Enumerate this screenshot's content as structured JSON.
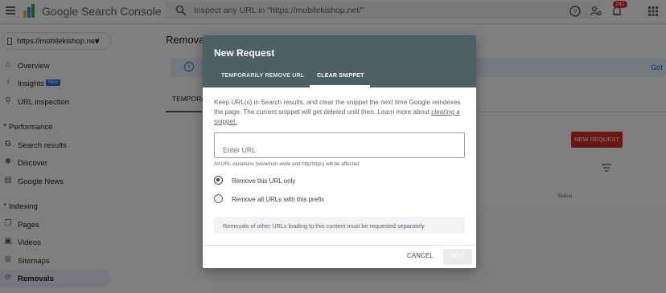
{
  "app": {
    "brand": "Google Search Console",
    "search_placeholder": "Inspect any URL in \"https://mobilekishop.net/\"",
    "notification_count": "241"
  },
  "sidebar": {
    "property": "https://mobilekishop.net/",
    "items": [
      {
        "label": "Overview",
        "icon": "home-icon"
      },
      {
        "label": "Insights",
        "icon": "lightbulb-icon",
        "badge": "New"
      },
      {
        "label": "URL inspection",
        "icon": "search-icon"
      },
      {
        "label": "Performance",
        "section": true
      },
      {
        "label": "Search results",
        "icon": "google-g-icon"
      },
      {
        "label": "Discover",
        "icon": "asterisk-icon"
      },
      {
        "label": "Google News",
        "icon": "news-icon"
      },
      {
        "label": "Indexing",
        "section": true
      },
      {
        "label": "Pages",
        "icon": "pages-icon"
      },
      {
        "label": "Videos",
        "icon": "videos-icon"
      },
      {
        "label": "Sitemaps",
        "icon": "sitemaps-icon"
      },
      {
        "label": "Removals",
        "icon": "removals-icon",
        "active": true
      }
    ]
  },
  "main": {
    "title": "Removals",
    "banner_action": "Got",
    "tab_label": "TEMPORA",
    "new_request_button": "NEW REQUEST",
    "status_column": "Status"
  },
  "dialog": {
    "title": "New Request",
    "tabs": [
      "TEMPORARILY REMOVE URL",
      "CLEAR SNIPPET"
    ],
    "active_tab": "CLEAR SNIPPET",
    "description": "Keep URL(s) in Search results, and clear the snippet the next time Google reindexes the page. The current snippet will get deleted until then. Learn more about ",
    "description_link": "clearing a snippet.",
    "url_placeholder": "Enter URL",
    "url_hint": "All URL variations (www/non-www and http/https) will be affected",
    "options": [
      "Remove this URL only",
      "Remove all URLs with this prefix"
    ],
    "selected_option": "Remove this URL only",
    "note": "Removals of other URLs leading to this content must be requested separately",
    "cancel_label": "CANCEL",
    "next_label": "NEXT"
  },
  "colors": {
    "dialog_header": "#4d6066",
    "accent_red": "#d93025",
    "accent_blue": "#1a73e8"
  }
}
